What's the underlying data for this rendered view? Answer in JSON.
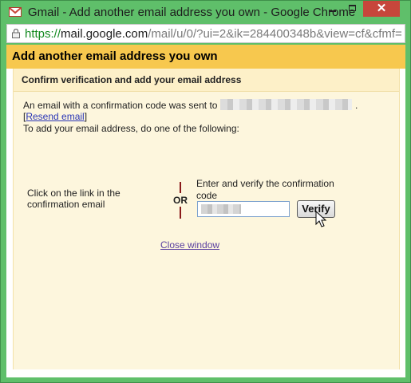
{
  "window": {
    "title": "Gmail - Add another email address you own - Google Chrome",
    "url_scheme": "https://",
    "url_host": "mail.google.com",
    "url_rest": "/mail/u/0/?ui=2&ik=284400348b&view=cf&cfmf=",
    "close_glyph": "✕"
  },
  "dialog": {
    "title": "Add another email address you own",
    "section_title": "Confirm verification and add your email address",
    "sent_text": "An email with a confirmation code was sent to",
    "sent_end": ".",
    "resend_open": "[",
    "resend_label": "Resend email",
    "resend_close": "]",
    "instruction": "To add your email address, do one of the following:",
    "option_link_text": "Click on the link in the confirmation email",
    "or_label": "OR",
    "option_code_text": "Enter and verify the confirmation code",
    "verify_label": "Verify",
    "close_link": "Close window"
  },
  "colors": {
    "frame": "#5fbf6a",
    "header": "#f7c84e",
    "panel": "#fdf6dd",
    "link": "#2a36b6",
    "close_button": "#c7463b"
  },
  "icons": [
    "gmail-icon",
    "lock-icon",
    "minimize-icon",
    "maximize-icon",
    "close-icon",
    "cursor-icon"
  ]
}
